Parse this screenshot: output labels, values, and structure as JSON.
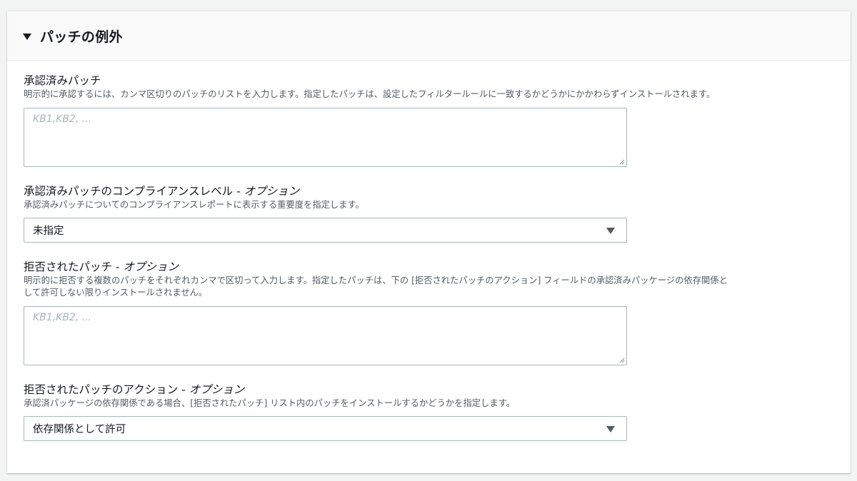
{
  "section": {
    "title": "パッチの例外"
  },
  "approved_patches": {
    "label": "承認済みパッチ",
    "description": "明示的に承認するには、カンマ区切りのパッチのリストを入力します。指定したパッチは、設定したフィルタールールに一致するかどうかにかかわらずインストールされます。",
    "placeholder": "KB1,KB2, ...",
    "value": ""
  },
  "approved_compliance": {
    "label": "承認済みパッチのコンプライアンスレベル - ",
    "label_optional": "オプション",
    "description": "承認済みパッチについてのコンプライアンスレポートに表示する重要度を指定します。",
    "selected": "未指定"
  },
  "rejected_patches": {
    "label": "拒否されたパッチ - ",
    "label_optional": "オプション",
    "description_line1": "明示的に拒否する複数のパッチをそれぞれカンマで区切って入力します。指定したパッチは、下の [拒否されたパッチのアクション] フィールドの承認済みパッケージの依存関係と",
    "description_line2": "して許可しない限りインストールされません。",
    "placeholder": "KB1,KB2, ...",
    "value": ""
  },
  "rejected_action": {
    "label": "拒否されたパッチのアクション - ",
    "label_optional": "オプション",
    "description": "承認済パッケージの依存関係である場合、[拒否されたパッチ] リスト内のパッチをインストールするかどうかを指定します。",
    "selected": "依存関係として許可"
  }
}
